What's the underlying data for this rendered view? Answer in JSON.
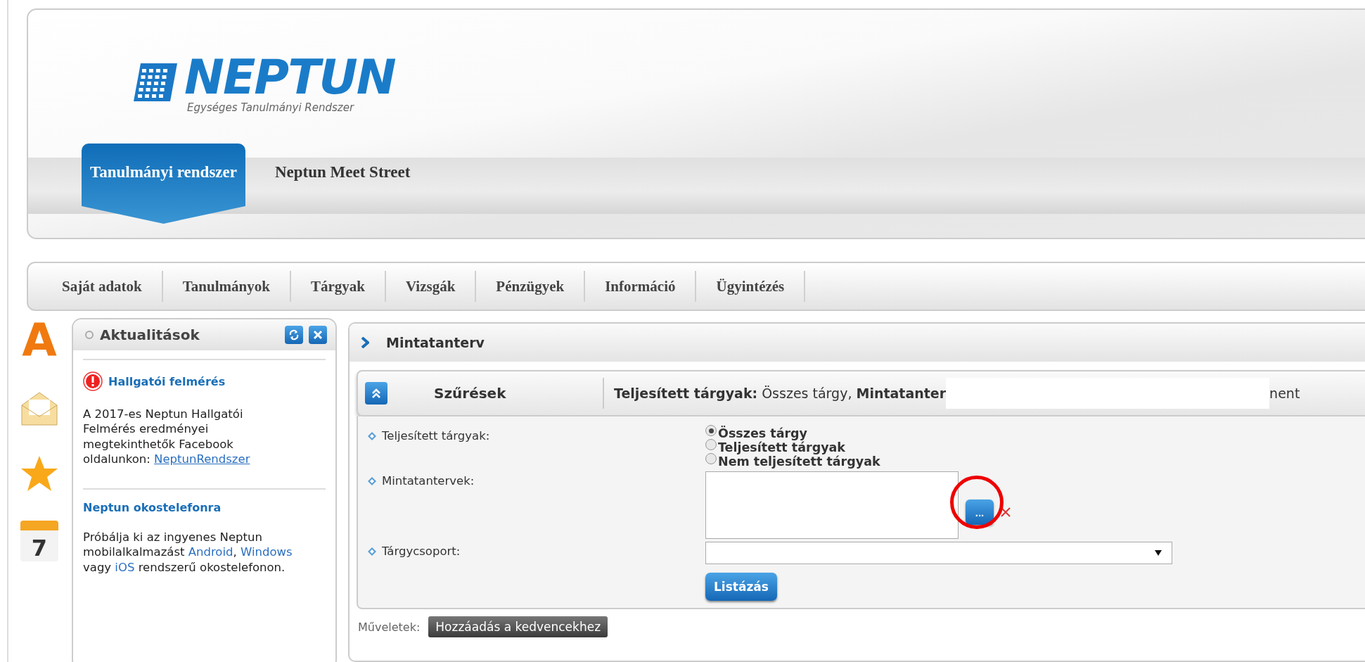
{
  "logo": {
    "name": "NEPTUN",
    "tagline": "Egységes Tanulmányi Rendszer"
  },
  "system_tabs": [
    {
      "label": "Tanulmányi rendszer",
      "selected": true
    },
    {
      "label": "Neptun Meet Street",
      "selected": false
    }
  ],
  "menu": [
    "Saját adatok",
    "Tanulmányok",
    "Tárgyak",
    "Vizsgák",
    "Pénzügyek",
    "Információ",
    "Ügyintézés"
  ],
  "shortcuts": [
    {
      "kind": "letter",
      "text": "A"
    },
    {
      "kind": "mail"
    },
    {
      "kind": "star"
    },
    {
      "kind": "calendar",
      "text": "7"
    }
  ],
  "news_panel": {
    "title": "Aktualitások",
    "items": [
      {
        "kind": "alert",
        "title": "Hallgatói felmérés",
        "parts": [
          {
            "text": "A 2017-es Neptun Hallgatói Felmérés eredményei megtekinthetők Facebook oldalunkon: ",
            "link": false
          },
          {
            "text": "NeptunRendszer",
            "link": true
          }
        ]
      },
      {
        "kind": "plain",
        "title": "Neptun okostelefonra",
        "parts": [
          {
            "text": "Próbálja ki az ingyenes Neptun mobilalkalmazást ",
            "link": false
          },
          {
            "text": "Android",
            "link": true
          },
          {
            "text": ", ",
            "link": false
          },
          {
            "text": "Windows",
            "link": true
          },
          {
            "text": " vagy ",
            "link": false
          },
          {
            "text": "iOS",
            "link": true
          },
          {
            "text": " rendszerű okostelefonon.",
            "link": false
          }
        ]
      }
    ]
  },
  "page_title": "Mintatanterv",
  "filter_bar": {
    "label": "Szűrések",
    "expanded": true,
    "summary": "**Teljesített tárgyak:** Összes tárgy, **Mintatanter**",
    "summary_end": "nent"
  },
  "form": {
    "fields": [
      {
        "kind": "radio",
        "label": "Teljesített tárgyak:",
        "options": [
          {
            "label": "Összes tárgy",
            "selected": true
          },
          {
            "label": "Teljesített tárgyak",
            "selected": false
          },
          {
            "label": "Nem teljesített tárgyak",
            "selected": false
          }
        ]
      },
      {
        "kind": "picker",
        "label": "Mintatantervek:",
        "button": "..."
      },
      {
        "kind": "select",
        "label": "Tárgycsoport:"
      }
    ],
    "submit": "Listázás"
  },
  "actions": {
    "label": "Műveletek:",
    "buttons": [
      "Hozzáadás a kedvencekhez"
    ]
  }
}
